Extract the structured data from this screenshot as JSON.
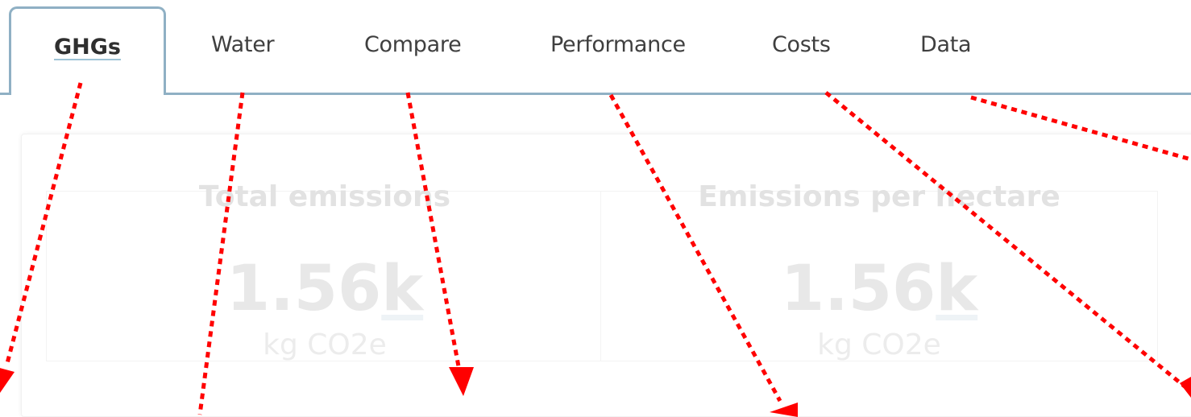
{
  "tabs": {
    "active": "GHGs",
    "items": [
      "GHGs",
      "Water",
      "Compare",
      "Performance",
      "Costs",
      "Data"
    ]
  },
  "cards": [
    {
      "title": "Total emissions",
      "value": "1.56",
      "suffix": "k",
      "unit": "kg CO2e"
    },
    {
      "title": "Emissions per hectare",
      "value": "1.56",
      "suffix": "k",
      "unit": "kg CO2e"
    }
  ],
  "colors": {
    "tab_border": "#8fb0c4",
    "arrow": "#ff0000"
  }
}
